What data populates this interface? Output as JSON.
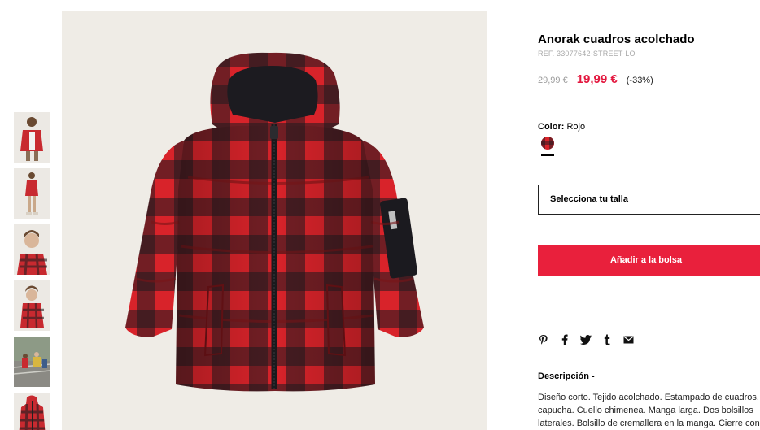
{
  "product": {
    "title": "Anorak cuadros acolchado",
    "ref": "REF. 33077642-STREET-LO",
    "old_price": "29,99 €",
    "new_price": "19,99 €",
    "discount": "(-33%)",
    "color_label": "Color:",
    "color_value": "Rojo",
    "size_placeholder": "Selecciona tu talla",
    "add_to_bag": "Añadir a la bolsa",
    "description_title": "Descripción -",
    "description_text": "Diseño corto. Tejido acolchado. Estampado de cuadros. capucha. Cuello chimenea. Manga larga. Dos bolsillos laterales. Bolsillo de cremallera en la manga. Cierre con cremallera en la parte delantera."
  },
  "colors": {
    "accent_red": "#e9203c",
    "price_red": "#e3173e",
    "plaid_red": "#d8232a",
    "plaid_dark": "#1e1a1f"
  },
  "thumbnails": [
    {
      "icon": "kid-wearing-jacket-open"
    },
    {
      "icon": "kid-full-body"
    },
    {
      "icon": "kid-closeup"
    },
    {
      "icon": "kid-hooded"
    },
    {
      "icon": "kids-outdoor-scene"
    },
    {
      "icon": "jacket-flat"
    }
  ],
  "share_icons": [
    "pinterest-icon",
    "facebook-icon",
    "twitter-icon",
    "tumblr-icon",
    "email-icon"
  ]
}
